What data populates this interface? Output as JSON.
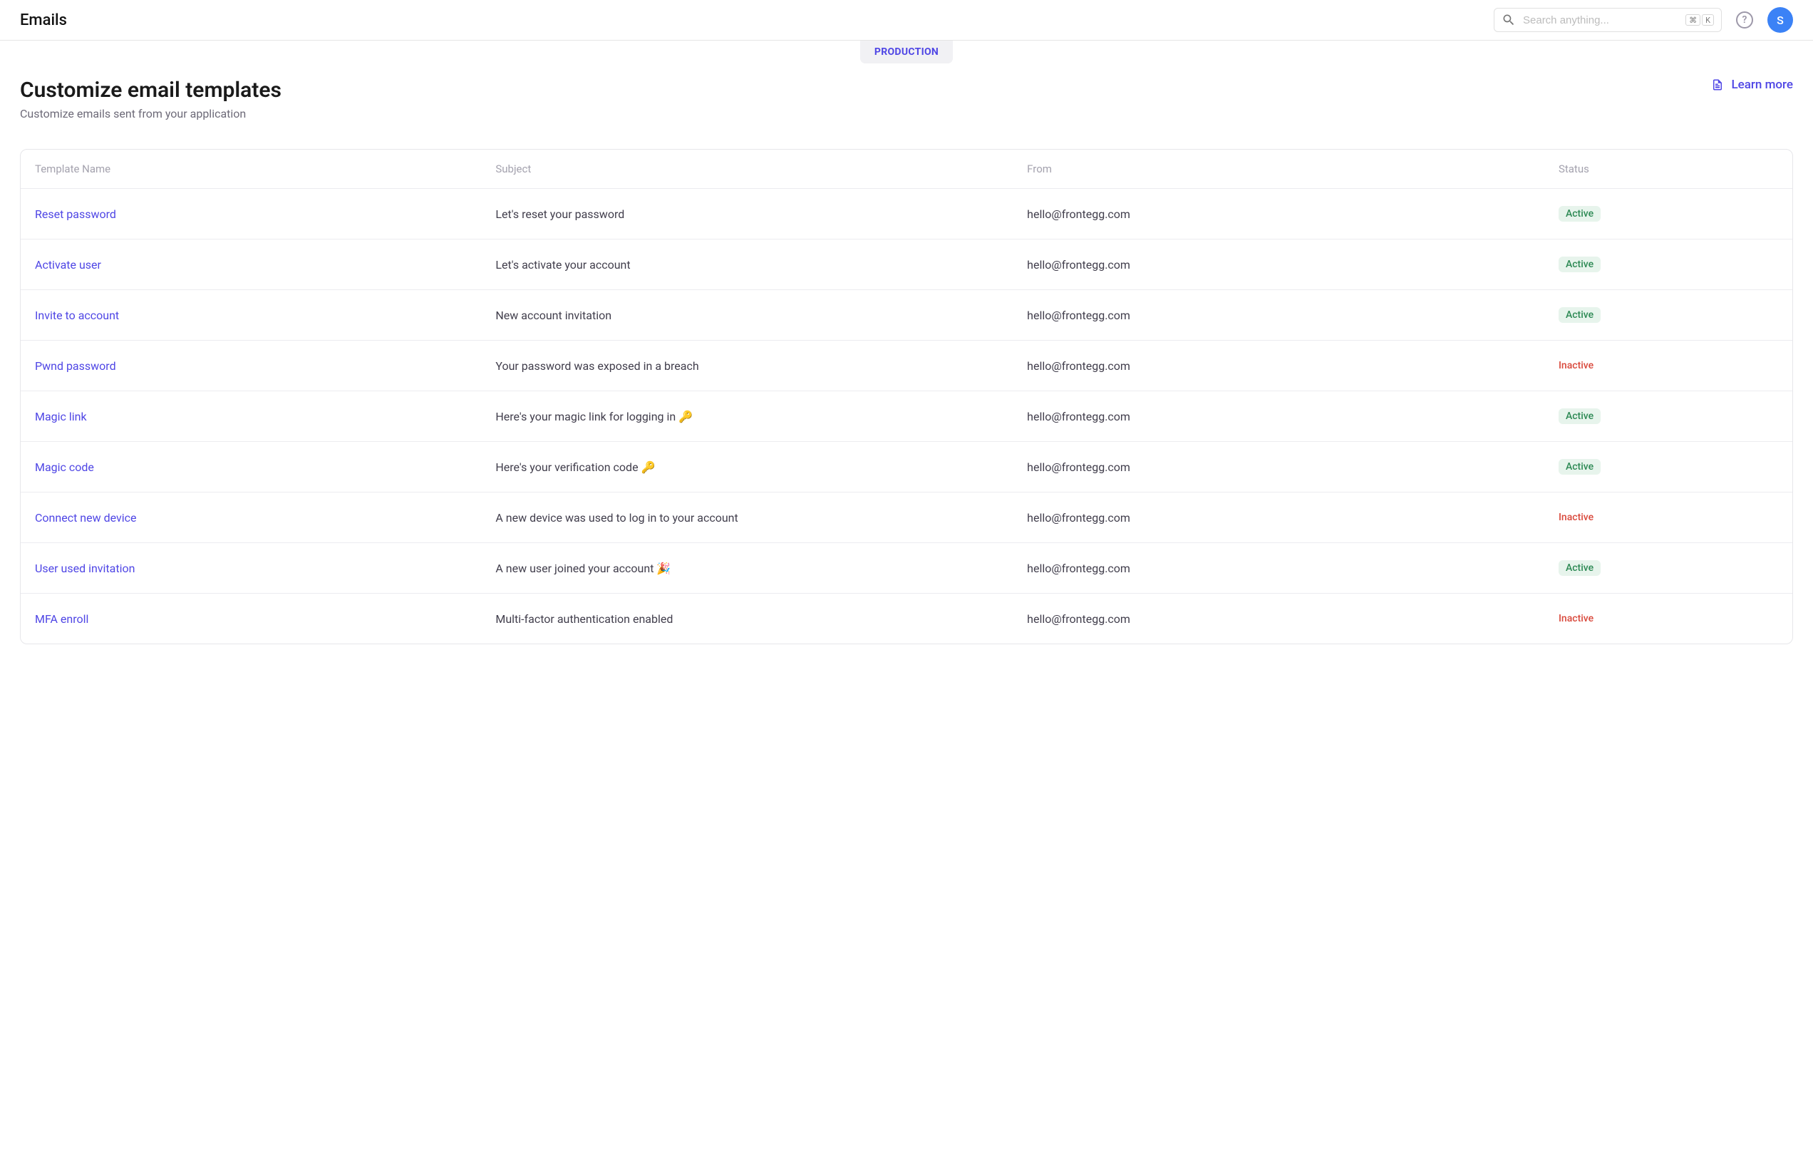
{
  "header": {
    "title": "Emails",
    "search_placeholder": "Search anything...",
    "kbd_cmd": "⌘",
    "kbd_k": "K",
    "help_label": "?",
    "avatar_initial": "S"
  },
  "env_badge": "PRODUCTION",
  "page": {
    "title": "Customize email templates",
    "subtitle": "Customize emails sent from your application",
    "learn_more": "Learn more"
  },
  "table": {
    "columns": {
      "name": "Template Name",
      "subject": "Subject",
      "from": "From",
      "status": "Status"
    },
    "rows": [
      {
        "name": "Reset password",
        "subject": "Let's reset your password",
        "from": "hello@frontegg.com",
        "status": "Active"
      },
      {
        "name": "Activate user",
        "subject": "Let's activate your account",
        "from": "hello@frontegg.com",
        "status": "Active"
      },
      {
        "name": "Invite to account",
        "subject": "New account invitation",
        "from": "hello@frontegg.com",
        "status": "Active"
      },
      {
        "name": "Pwnd password",
        "subject": "Your password was exposed in a breach",
        "from": "hello@frontegg.com",
        "status": "Inactive"
      },
      {
        "name": "Magic link",
        "subject": "Here's your magic link for logging in 🔑",
        "from": "hello@frontegg.com",
        "status": "Active"
      },
      {
        "name": "Magic code",
        "subject": "Here's your verification code 🔑",
        "from": "hello@frontegg.com",
        "status": "Active"
      },
      {
        "name": "Connect new device",
        "subject": "A new device was used to log in to your account",
        "from": "hello@frontegg.com",
        "status": "Inactive"
      },
      {
        "name": "User used invitation",
        "subject": "A new user joined your account 🎉",
        "from": "hello@frontegg.com",
        "status": "Active"
      },
      {
        "name": "MFA enroll",
        "subject": "Multi-factor authentication enabled",
        "from": "hello@frontegg.com",
        "status": "Inactive"
      }
    ]
  }
}
